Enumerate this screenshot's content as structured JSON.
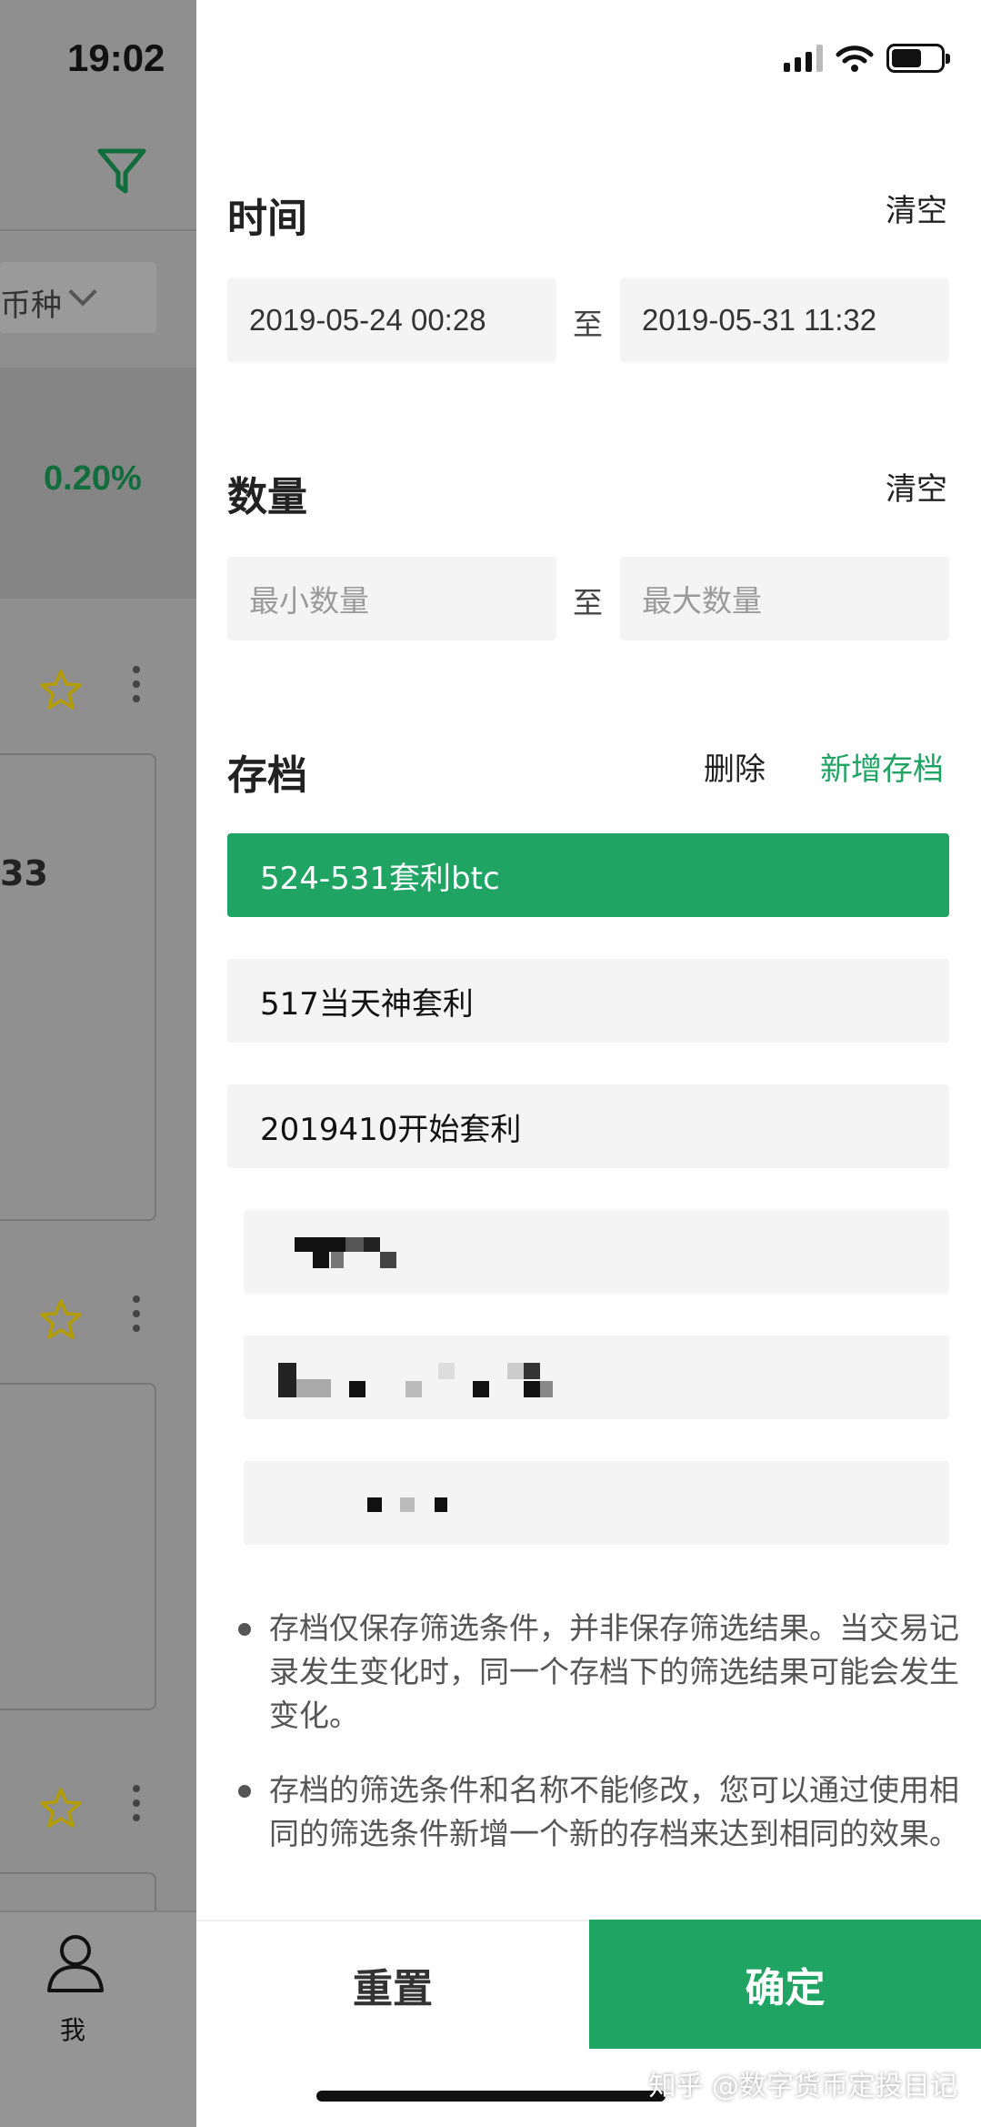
{
  "status_bar": {
    "time": "19:02"
  },
  "background": {
    "coin_filter_label": "币种",
    "change_pct": "0.20%",
    "partial_number": "33",
    "tab_me": "我"
  },
  "drawer": {
    "time_section": {
      "title": "时间",
      "clear": "清空",
      "start": "2019-05-24 00:28",
      "separator": "至",
      "end": "2019-05-31 11:32"
    },
    "quantity_section": {
      "title": "数量",
      "clear": "清空",
      "min_placeholder": "最小数量",
      "separator": "至",
      "max_placeholder": "最大数量"
    },
    "archive_section": {
      "title": "存档",
      "delete": "删除",
      "add": "新增存档",
      "items": [
        {
          "label": "524-531套利btc",
          "selected": true
        },
        {
          "label": "517当天神套利",
          "selected": false
        },
        {
          "label": "2019410开始套利",
          "selected": false
        }
      ]
    },
    "notes": [
      "存档仅保存筛选条件，并非保存筛选结果。当交易记录发生变化时，同一个存档下的筛选结果可能会发生变化。",
      "存档的筛选条件和名称不能修改，您可以通过使用相同的筛选条件新增一个新的存档来达到相同的效果。"
    ],
    "buttons": {
      "reset": "重置",
      "confirm": "确定"
    }
  },
  "watermark": "知乎 @数字货币定投日记",
  "colors": {
    "accent": "#1fa463",
    "dim_green": "#116d3c",
    "star": "#c9b100"
  }
}
